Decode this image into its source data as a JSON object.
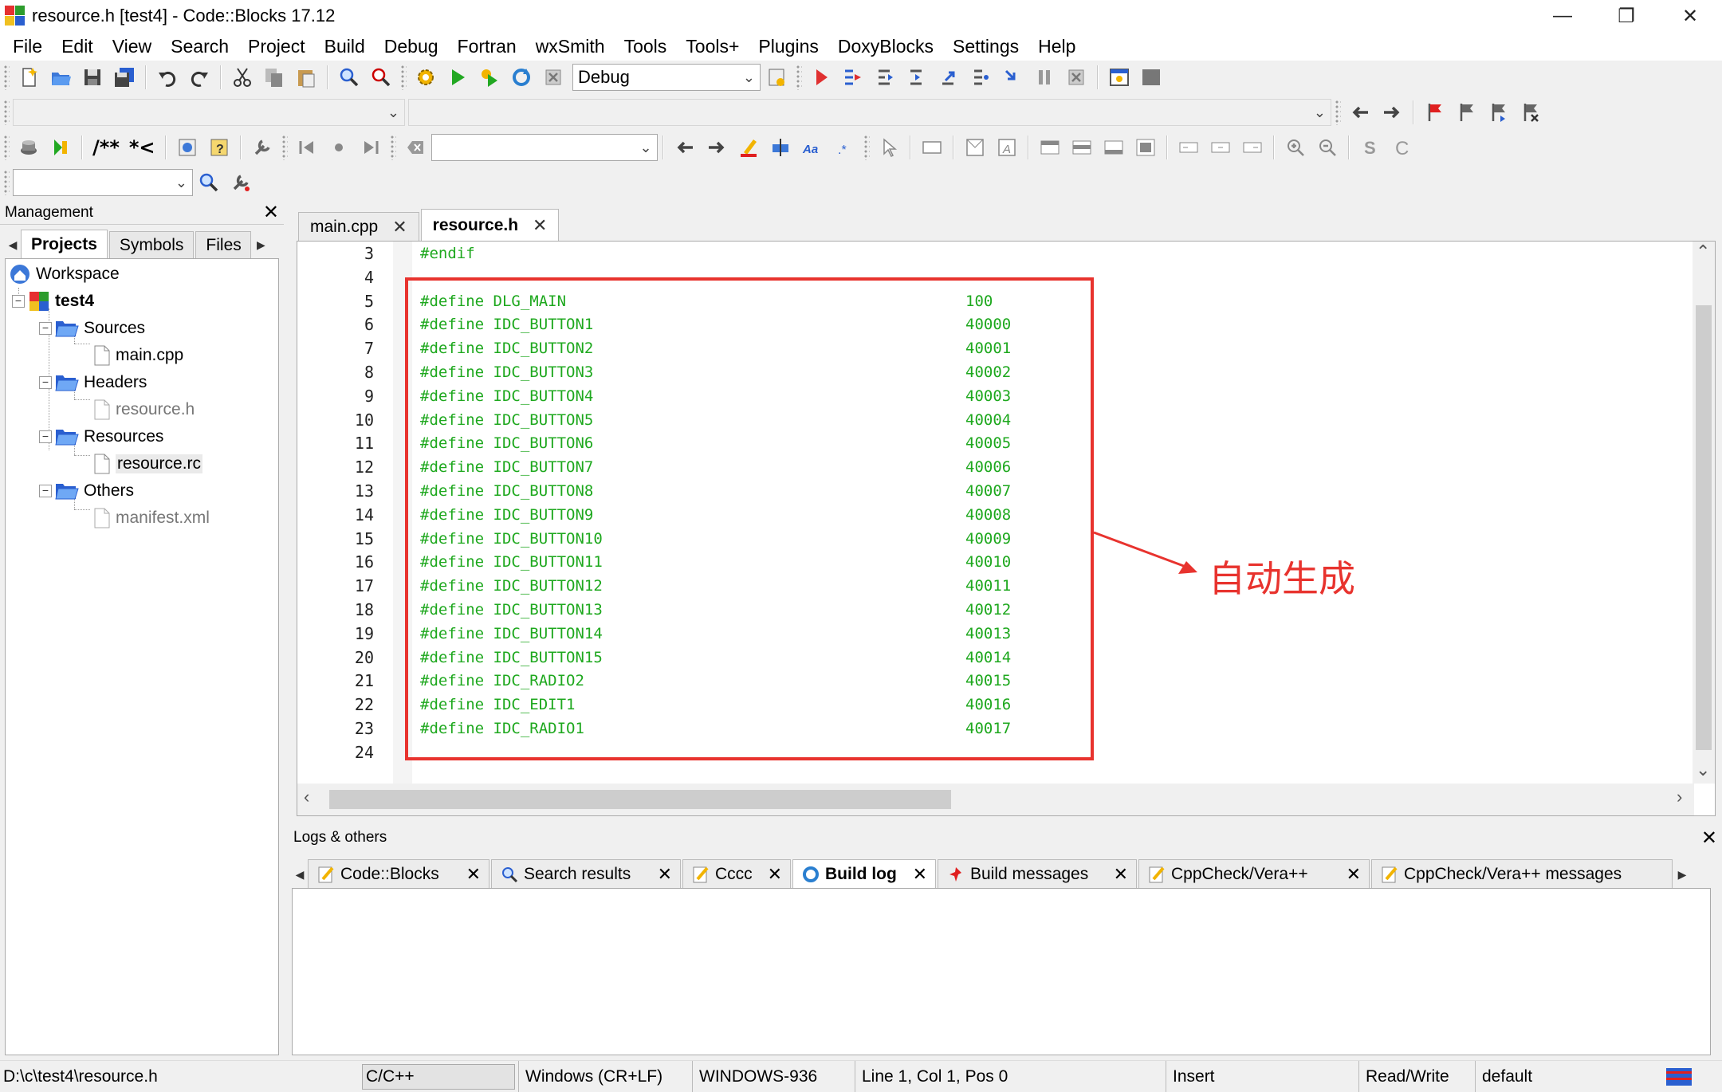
{
  "window": {
    "title": "resource.h [test4] - Code::Blocks 17.12"
  },
  "menu": [
    "File",
    "Edit",
    "View",
    "Search",
    "Project",
    "Build",
    "Debug",
    "Fortran",
    "wxSmith",
    "Tools",
    "Tools+",
    "Plugins",
    "DoxyBlocks",
    "Settings",
    "Help"
  ],
  "toolbar": {
    "build_target": "Debug",
    "comment_block": "/**",
    "comment_line": "*<"
  },
  "management": {
    "title": "Management",
    "tabs": [
      "Projects",
      "Symbols",
      "Files"
    ],
    "tree": {
      "workspace": "Workspace",
      "project": "test4",
      "sources": "Sources",
      "main_cpp": "main.cpp",
      "headers": "Headers",
      "resource_h": "resource.h",
      "resources": "Resources",
      "resource_rc": "resource.rc",
      "others": "Others",
      "manifest": "manifest.xml"
    }
  },
  "editor": {
    "tabs": [
      "main.cpp",
      "resource.h"
    ],
    "active_tab": "resource.h",
    "lines": [
      {
        "n": "3",
        "code": "#endif",
        "val": ""
      },
      {
        "n": "4",
        "code": "",
        "val": ""
      },
      {
        "n": "5",
        "code": "#define DLG_MAIN",
        "val": "100"
      },
      {
        "n": "6",
        "code": "#define IDC_BUTTON1",
        "val": "40000"
      },
      {
        "n": "7",
        "code": "#define IDC_BUTTON2",
        "val": "40001"
      },
      {
        "n": "8",
        "code": "#define IDC_BUTTON3",
        "val": "40002"
      },
      {
        "n": "9",
        "code": "#define IDC_BUTTON4",
        "val": "40003"
      },
      {
        "n": "10",
        "code": "#define IDC_BUTTON5",
        "val": "40004"
      },
      {
        "n": "11",
        "code": "#define IDC_BUTTON6",
        "val": "40005"
      },
      {
        "n": "12",
        "code": "#define IDC_BUTTON7",
        "val": "40006"
      },
      {
        "n": "13",
        "code": "#define IDC_BUTTON8",
        "val": "40007"
      },
      {
        "n": "14",
        "code": "#define IDC_BUTTON9",
        "val": "40008"
      },
      {
        "n": "15",
        "code": "#define IDC_BUTTON10",
        "val": "40009"
      },
      {
        "n": "16",
        "code": "#define IDC_BUTTON11",
        "val": "40010"
      },
      {
        "n": "17",
        "code": "#define IDC_BUTTON12",
        "val": "40011"
      },
      {
        "n": "18",
        "code": "#define IDC_BUTTON13",
        "val": "40012"
      },
      {
        "n": "19",
        "code": "#define IDC_BUTTON14",
        "val": "40013"
      },
      {
        "n": "20",
        "code": "#define IDC_BUTTON15",
        "val": "40014"
      },
      {
        "n": "21",
        "code": "#define IDC_RADIO2",
        "val": "40015"
      },
      {
        "n": "22",
        "code": "#define IDC_EDIT1",
        "val": "40016"
      },
      {
        "n": "23",
        "code": "#define IDC_RADIO1",
        "val": "40017"
      },
      {
        "n": "24",
        "code": "",
        "val": ""
      }
    ],
    "annotation": "自动生成",
    "annotation_color": "#e8332e",
    "code_color": "#1ea81e"
  },
  "logs": {
    "title": "Logs & others",
    "tabs": [
      "Code::Blocks",
      "Search results",
      "Cccc",
      "Build log",
      "Build messages",
      "CppCheck/Vera++",
      "CppCheck/Vera++ messages"
    ],
    "active_tab": "Build log"
  },
  "status": {
    "path": "D:\\c\\test4\\resource.h",
    "language": "C/C++",
    "line_endings": "Windows (CR+LF)",
    "encoding": "WINDOWS-936",
    "position": "Line 1, Col 1, Pos 0",
    "mode": "Insert",
    "access": "Read/Write",
    "profile": "default"
  }
}
